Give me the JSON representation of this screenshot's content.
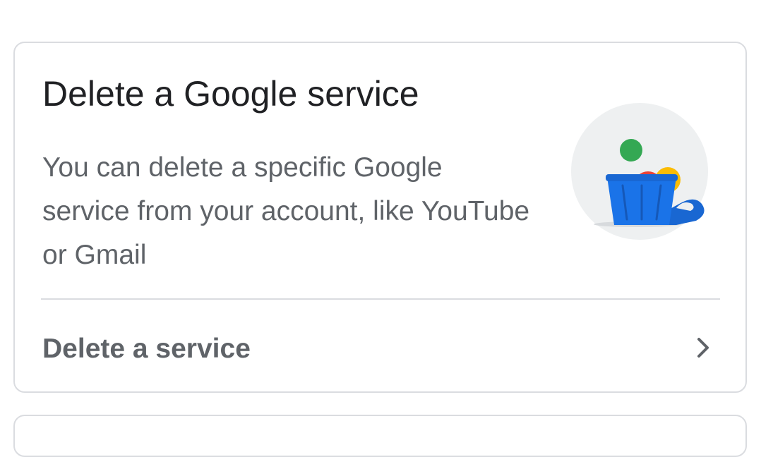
{
  "card": {
    "title": "Delete a Google service",
    "description": "You can delete a specific Google service from your account, like YouTube or Gmail",
    "action_label": "Delete a service",
    "illustration_icon": "trash-can-icon",
    "chevron_icon": "chevron-right-icon"
  },
  "colors": {
    "title_text": "#202124",
    "secondary_text": "#5f6368",
    "border": "#dadce0",
    "trash_blue": "#1a73e8",
    "ball_green": "#34a853",
    "ball_red": "#ea4335",
    "ball_yellow": "#fbbc04",
    "circle_bg": "#eef0f1"
  }
}
